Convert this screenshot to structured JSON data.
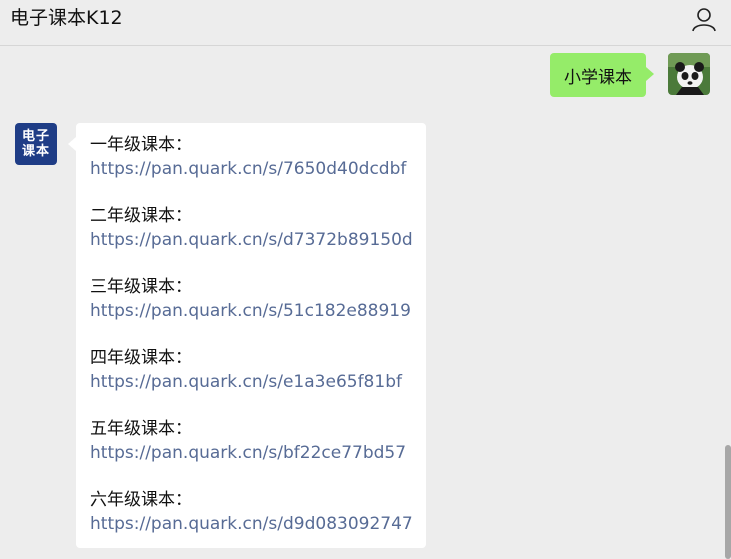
{
  "header": {
    "title": "电子课本K12",
    "user_icon": "user-icon"
  },
  "outgoing": {
    "text": "小学课本",
    "bubble_color": "#95ec69",
    "avatar_icon": "panda-avatar"
  },
  "incoming": {
    "avatar_text_line1": "电子",
    "avatar_text_line2": "课本",
    "avatar_color": "#1f3d86",
    "link_color": "#576b95",
    "grades": [
      {
        "label": "一年级课本：",
        "link": "https://pan.quark.cn/s/7650d40dcdbf"
      },
      {
        "label": "二年级课本：",
        "link": "https://pan.quark.cn/s/d7372b89150d"
      },
      {
        "label": "三年级课本：",
        "link": "https://pan.quark.cn/s/51c182e88919"
      },
      {
        "label": "四年级课本：",
        "link": "https://pan.quark.cn/s/e1a3e65f81bf"
      },
      {
        "label": "五年级课本：",
        "link": "https://pan.quark.cn/s/bf22ce77bd57"
      },
      {
        "label": "六年级课本：",
        "link": "https://pan.quark.cn/s/d9d083092747"
      }
    ]
  }
}
